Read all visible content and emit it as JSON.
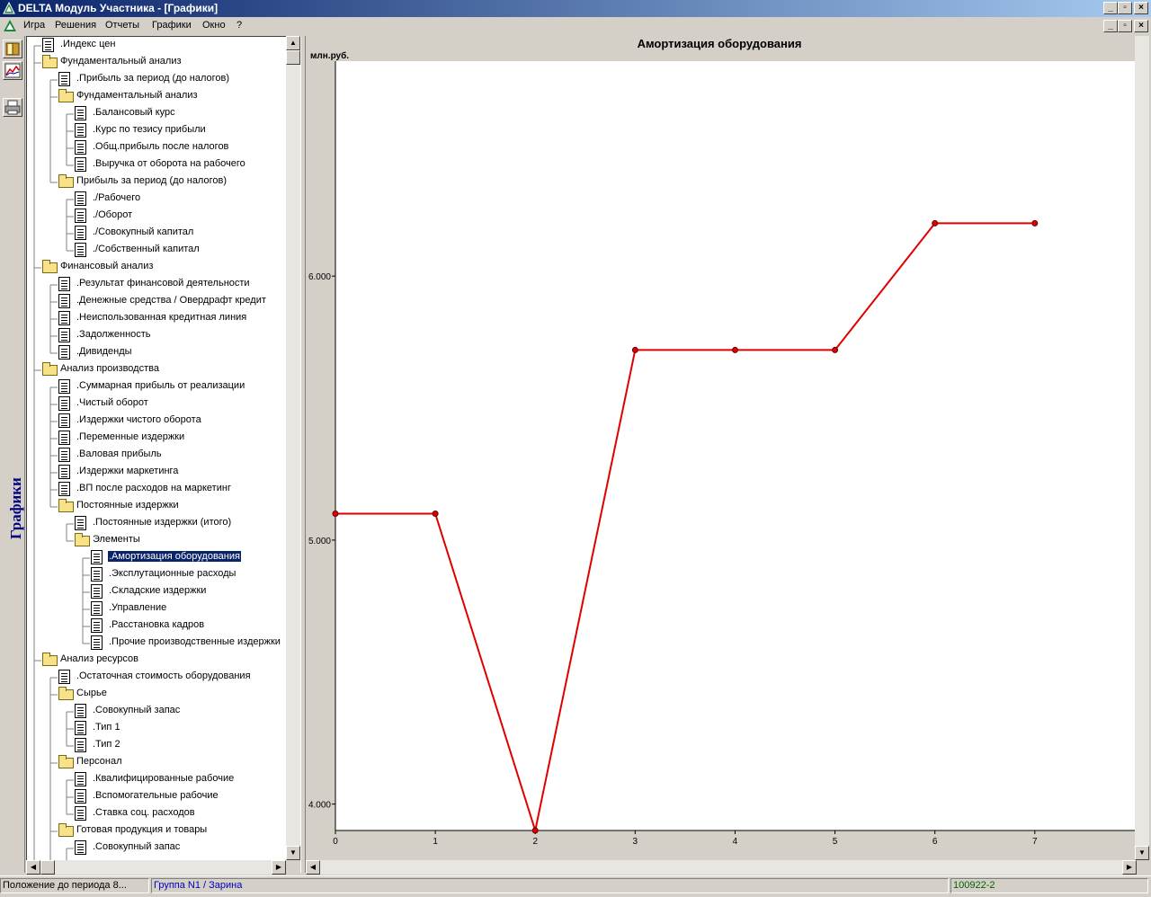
{
  "window": {
    "title": "DELTA Модуль Участника - [Графики]",
    "btn_min": "_",
    "btn_max": "▫",
    "btn_close": "×"
  },
  "menu": [
    {
      "label": "Игра",
      "name": "menu-game"
    },
    {
      "label": "Решения",
      "name": "menu-decisions"
    },
    {
      "label": "Отчеты",
      "name": "menu-reports"
    },
    {
      "label": "Графики",
      "name": "menu-charts"
    },
    {
      "label": "Окно",
      "name": "menu-window"
    },
    {
      "label": "?",
      "name": "menu-help"
    }
  ],
  "left_panel": {
    "vertical_label": "Графики",
    "tools": [
      {
        "icon": "book-icon"
      },
      {
        "icon": "chart-icon"
      },
      {
        "icon": "printer-icon"
      }
    ]
  },
  "tree": [
    {
      "label": ".Индекс цен",
      "level": 0,
      "type": "doc"
    },
    {
      "label": "Фундаментальный анализ",
      "level": 0,
      "type": "folder"
    },
    {
      "label": ".Прибыль за период (до налогов)",
      "level": 1,
      "type": "doc"
    },
    {
      "label": "Фундаментальный анализ",
      "level": 1,
      "type": "folder"
    },
    {
      "label": ".Балансовый курс",
      "level": 2,
      "type": "doc"
    },
    {
      "label": ".Курс по тезису прибыли",
      "level": 2,
      "type": "doc"
    },
    {
      "label": ".Общ.прибыль после налогов",
      "level": 2,
      "type": "doc"
    },
    {
      "label": ".Выручка от оборота на рабочего",
      "level": 2,
      "type": "doc"
    },
    {
      "label": "Прибыль за период (до налогов)",
      "level": 1,
      "type": "folder"
    },
    {
      "label": "./Рабочего",
      "level": 2,
      "type": "doc"
    },
    {
      "label": "./Оборот",
      "level": 2,
      "type": "doc"
    },
    {
      "label": "./Совокупный капитал",
      "level": 2,
      "type": "doc"
    },
    {
      "label": "./Собственный капитал",
      "level": 2,
      "type": "doc"
    },
    {
      "label": "Финансовый анализ",
      "level": 0,
      "type": "folder"
    },
    {
      "label": ".Результат финансовой деятельности",
      "level": 1,
      "type": "doc"
    },
    {
      "label": ".Денежные средства / Овердрафт кредит",
      "level": 1,
      "type": "doc"
    },
    {
      "label": ".Неиспользованная кредитная линия",
      "level": 1,
      "type": "doc"
    },
    {
      "label": ".Задолженность",
      "level": 1,
      "type": "doc"
    },
    {
      "label": ".Дивиденды",
      "level": 1,
      "type": "doc"
    },
    {
      "label": "Анализ производства",
      "level": 0,
      "type": "folder"
    },
    {
      "label": ".Суммарная прибыль от реализации",
      "level": 1,
      "type": "doc"
    },
    {
      "label": ".Чистый оборот",
      "level": 1,
      "type": "doc"
    },
    {
      "label": ".Издержки чистого оборота",
      "level": 1,
      "type": "doc"
    },
    {
      "label": ".Переменные издержки",
      "level": 1,
      "type": "doc"
    },
    {
      "label": ".Валовая прибыль",
      "level": 1,
      "type": "doc"
    },
    {
      "label": ".Издержки маркетинга",
      "level": 1,
      "type": "doc"
    },
    {
      "label": ".ВП после расходов на маркетинг",
      "level": 1,
      "type": "doc"
    },
    {
      "label": "Постоянные издержки",
      "level": 1,
      "type": "folder"
    },
    {
      "label": ".Постоянные издержки (итого)",
      "level": 2,
      "type": "doc"
    },
    {
      "label": "Элементы",
      "level": 2,
      "type": "folder"
    },
    {
      "label": ".Амортизация оборудования",
      "level": 3,
      "type": "doc",
      "selected": true
    },
    {
      "label": ".Эксплутационные расходы",
      "level": 3,
      "type": "doc"
    },
    {
      "label": ".Складские издержки",
      "level": 3,
      "type": "doc"
    },
    {
      "label": ".Управление",
      "level": 3,
      "type": "doc"
    },
    {
      "label": ".Расстановка кадров",
      "level": 3,
      "type": "doc"
    },
    {
      "label": ".Прочие производственные издержки",
      "level": 3,
      "type": "doc"
    },
    {
      "label": "Анализ ресурсов",
      "level": 0,
      "type": "folder"
    },
    {
      "label": ".Остаточная стоимость оборудования",
      "level": 1,
      "type": "doc"
    },
    {
      "label": "Сырье",
      "level": 1,
      "type": "folder"
    },
    {
      "label": ".Совокупный запас",
      "level": 2,
      "type": "doc"
    },
    {
      "label": ".Тип 1",
      "level": 2,
      "type": "doc"
    },
    {
      "label": ".Тип 2",
      "level": 2,
      "type": "doc"
    },
    {
      "label": "Персонал",
      "level": 1,
      "type": "folder"
    },
    {
      "label": ".Квалифицированные рабочие",
      "level": 2,
      "type": "doc"
    },
    {
      "label": ".Вспомогательные рабочие",
      "level": 2,
      "type": "doc"
    },
    {
      "label": ".Ставка соц. расходов",
      "level": 2,
      "type": "doc"
    },
    {
      "label": "Готовая продукция и товары",
      "level": 1,
      "type": "folder"
    },
    {
      "label": ".Совокупный запас",
      "level": 2,
      "type": "doc"
    }
  ],
  "chart_data": {
    "type": "line",
    "title": "Амортизация оборудования",
    "ylabel": "млн.руб.",
    "x": [
      0,
      1,
      2,
      3,
      4,
      5,
      6,
      7
    ],
    "y": [
      5.1,
      5.1,
      3.9,
      5.72,
      5.72,
      5.72,
      6.2,
      6.2
    ],
    "x_ticks": [
      "0",
      "1",
      "2",
      "3",
      "4",
      "5",
      "6",
      "7"
    ],
    "y_ticks": [
      {
        "value": 4.0,
        "label": "4.000"
      },
      {
        "value": 5.0,
        "label": "5.000"
      },
      {
        "value": 6.0,
        "label": "6.000"
      }
    ],
    "xlim": [
      0,
      8
    ],
    "ylim": [
      3.9,
      6.45
    ],
    "line_color": "#e00000",
    "grid": false
  },
  "status": {
    "position": "Положение до периода 8...",
    "group": "Группа N1 / Зарина",
    "code": "100922-2"
  },
  "colors": {
    "selection": "#0a246a",
    "group_text": "#0000c0",
    "code_text": "#006000",
    "vertical_label": "#000080"
  }
}
